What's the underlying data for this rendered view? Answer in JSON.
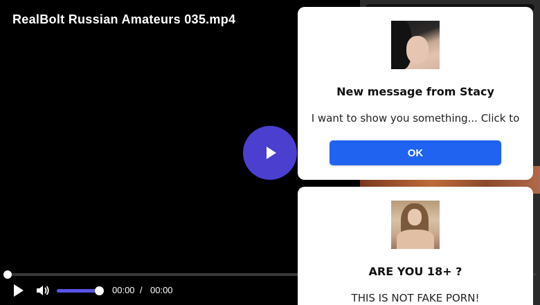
{
  "video": {
    "title": "RealBolt Russian Amateurs 035.mp4",
    "time_current": "00:00",
    "time_separator": "/",
    "time_total": "00:00",
    "progress": 0,
    "volume": 1.0,
    "accent_color": "#4b3fcf"
  },
  "notifications": [
    {
      "heading": "New message from Stacy",
      "text": "I want to show you something... Click to",
      "button_label": "OK",
      "button_color": "#1f63f0"
    },
    {
      "heading": "ARE YOU 18+ ?",
      "text": "THIS IS NOT FAKE PORN!"
    }
  ],
  "icons": {
    "big_play": "play-icon",
    "control_play": "play-icon",
    "volume": "volume-icon"
  }
}
